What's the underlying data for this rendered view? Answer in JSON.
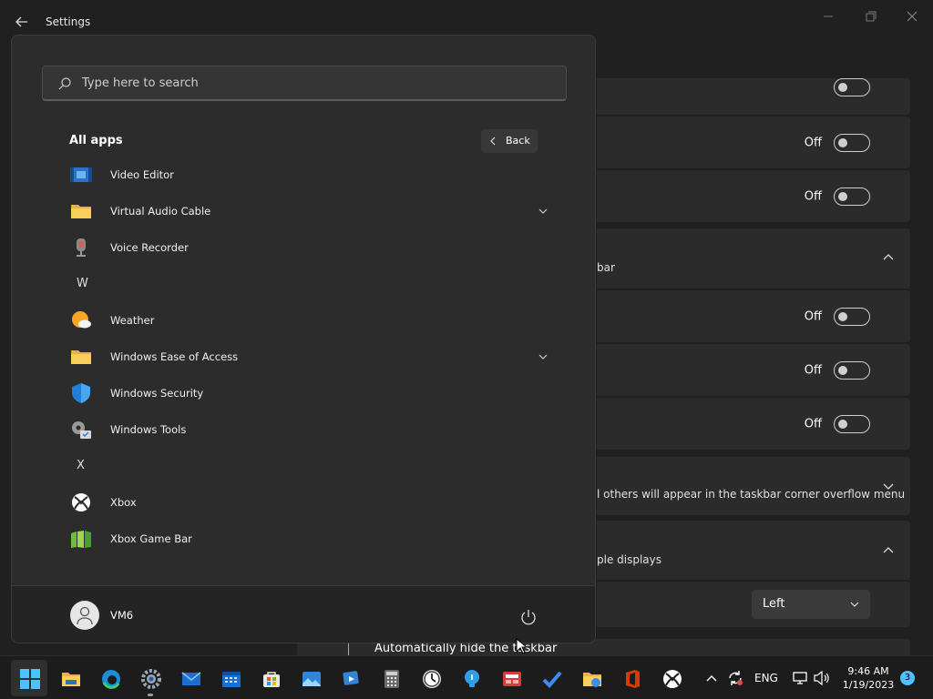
{
  "window": {
    "title": "Settings"
  },
  "settings": {
    "rows": [
      {
        "kind": "toggle",
        "label": "Off"
      },
      {
        "kind": "toggle",
        "label": "Off"
      },
      {
        "kind": "header",
        "text": "bar"
      },
      {
        "kind": "toggle",
        "label": "Off"
      },
      {
        "kind": "toggle",
        "label": "Off"
      },
      {
        "kind": "toggle",
        "label": "Off"
      },
      {
        "kind": "header",
        "text": "l others will appear in the taskbar corner overflow menu"
      },
      {
        "kind": "header",
        "text": "ple displays"
      }
    ],
    "dropdown_value": "Left",
    "auto_hide_label": "Automatically hide the taskbar"
  },
  "start_menu": {
    "search_placeholder": "Type here to search",
    "all_apps_title": "All apps",
    "back_label": "Back",
    "apps": [
      {
        "label": "Video Editor",
        "icon": "video-editor-icon",
        "expandable": false
      },
      {
        "label": "Virtual Audio Cable",
        "icon": "folder-icon",
        "expandable": true
      },
      {
        "label": "Voice Recorder",
        "icon": "microphone-icon",
        "expandable": false
      },
      {
        "letter": "W"
      },
      {
        "label": "Weather",
        "icon": "weather-icon",
        "expandable": false
      },
      {
        "label": "Windows Ease of Access",
        "icon": "folder-icon",
        "expandable": true
      },
      {
        "label": "Windows Security",
        "icon": "shield-icon",
        "expandable": false
      },
      {
        "label": "Windows Tools",
        "icon": "gear-icon",
        "expandable": false
      },
      {
        "letter": "X"
      },
      {
        "label": "Xbox",
        "icon": "xbox-icon",
        "expandable": false
      },
      {
        "label": "Xbox Game Bar",
        "icon": "xbox-game-bar-icon",
        "expandable": false
      }
    ],
    "user_name": "VM6"
  },
  "taskbar": {
    "language": "ENG",
    "time": "9:46 AM",
    "date": "1/19/2023",
    "notification_count": "3"
  },
  "colors": {
    "accent": "#0078d4",
    "background": "#202020",
    "start_bg": "#2c2c2c"
  }
}
